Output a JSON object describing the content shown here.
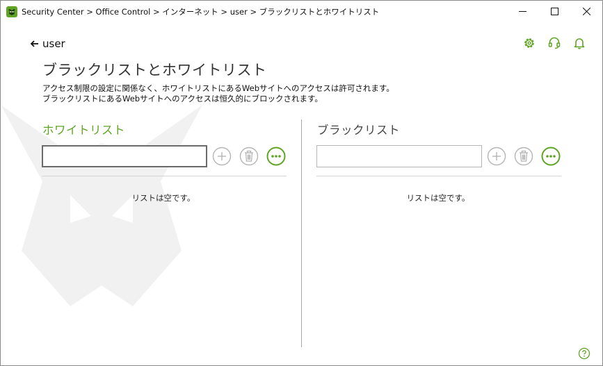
{
  "window": {
    "title": "Security Center > Office Control > インターネット > user > ブラックリストとホワイトリスト"
  },
  "nav": {
    "back_label": "user"
  },
  "page": {
    "title": "ブラックリストとホワイトリスト",
    "description_line1": "アクセス制限の設定に関係なく、ホワイトリストにあるWebサイトへのアクセスは許可されます。",
    "description_line2": "ブラックリストにあるWebサイトへのアクセスは恒久的にブロックされます。"
  },
  "whitelist": {
    "title": "ホワイトリスト",
    "input_value": "",
    "empty_text": "リストは空です。"
  },
  "blacklist": {
    "title": "ブラックリスト",
    "input_value": "",
    "empty_text": "リストは空です。"
  },
  "icons": {
    "app": "dr-web-spider-icon",
    "back": "arrow-left-icon",
    "settings": "gear-icon",
    "support": "headset-icon",
    "notifications": "bell-icon",
    "add": "plus-icon",
    "delete": "trash-icon",
    "more": "ellipsis-icon",
    "help": "question-icon"
  },
  "colors": {
    "accent_green": "#5fa424",
    "disabled_gray": "#b5b5b5",
    "text_dark": "#111111"
  }
}
